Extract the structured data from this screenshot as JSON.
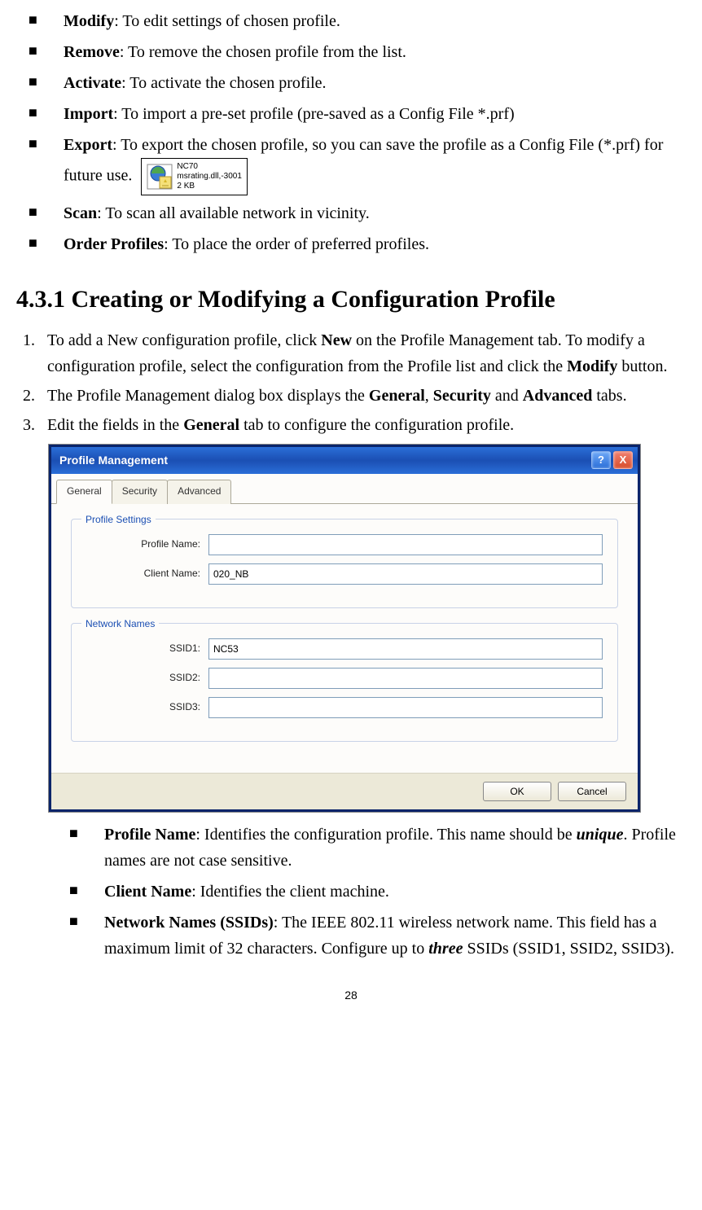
{
  "bullets_top": [
    {
      "term": "Modify",
      "desc": ": To edit settings of chosen profile."
    },
    {
      "term": "Remove",
      "desc": ": To remove the chosen profile from the list."
    },
    {
      "term": "Activate",
      "desc": ": To activate the chosen profile."
    },
    {
      "term": "Import",
      "desc": ": To import a pre-set profile (pre-saved as a Config File *.prf)"
    },
    {
      "term": "Export",
      "desc": ": To export the chosen profile, so you can save the profile as a Config File (*.prf) for future use. "
    },
    {
      "term": "Scan",
      "desc": ": To scan all available network in vicinity."
    },
    {
      "term": "Order Profiles",
      "desc": ": To place the order of preferred profiles."
    }
  ],
  "file_icon": {
    "name": "NC70",
    "detail": "msrating.dll,-3001",
    "size": "2 KB"
  },
  "section_heading": "4.3.1 Creating or Modifying a Configuration Profile",
  "steps": [
    {
      "pre": "To add a New configuration profile, click ",
      "b1": "New",
      "mid1": " on the Profile Management tab. To modify a configuration profile, select the configuration from the Profile list and click the ",
      "b2": "Modify",
      "post": " button."
    },
    {
      "pre": "The Profile Management dialog box displays the ",
      "b1": "General",
      "mid1": ", ",
      "b2": "Security",
      "mid2": " and ",
      "b3": "Advanced",
      "post": " tabs."
    },
    {
      "pre": "Edit the fields in the ",
      "b1": "General",
      "post": " tab to configure the configuration profile."
    }
  ],
  "dialog": {
    "title": "Profile Management",
    "help": "?",
    "close": "X",
    "tabs": {
      "general": "General",
      "security": "Security",
      "advanced": "Advanced"
    },
    "group1": {
      "legend": "Profile Settings",
      "profile_name_label": "Profile Name:",
      "profile_name_value": "",
      "client_name_label": "Client Name:",
      "client_name_value": "020_NB"
    },
    "group2": {
      "legend": "Network Names",
      "ssid1_label": "SSID1:",
      "ssid1_value": "NC53",
      "ssid2_label": "SSID2:",
      "ssid2_value": "",
      "ssid3_label": "SSID3:",
      "ssid3_value": ""
    },
    "buttons": {
      "ok": "OK",
      "cancel": "Cancel"
    }
  },
  "bullets_bottom": [
    {
      "term": "Profile Name",
      "after_term": ": Identifies the configuration profile. This name should be ",
      "em": "unique",
      "tail": ". Profile names are not case sensitive."
    },
    {
      "term": "Client Name",
      "after_term": ": Identifies the client machine."
    },
    {
      "term": "Network Names (SSIDs)",
      "after_term": ": The IEEE 802.11 wireless network name. This field has a maximum limit of 32 characters. Configure up to ",
      "em": "three",
      "tail": " SSIDs (SSID1, SSID2, SSID3)."
    }
  ],
  "page_number": "28"
}
